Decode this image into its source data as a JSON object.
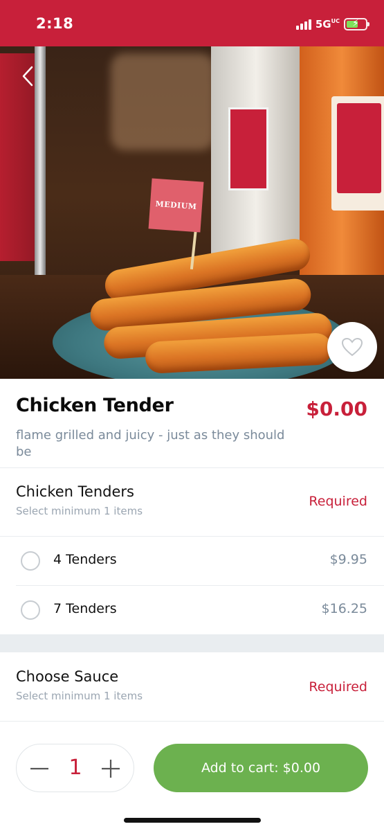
{
  "status_bar": {
    "time": "2:18",
    "network": "5G",
    "network_suffix": "UC",
    "bg_color": "#c8203a"
  },
  "hero": {
    "flag_text": "MEDIUM",
    "back_icon": "chevron-left-icon",
    "favorite_icon": "heart-outline-icon"
  },
  "product": {
    "title": "Chicken Tender",
    "price": "$0.00",
    "description": "flame grilled and juicy - just as they should be"
  },
  "groups": [
    {
      "title": "Chicken Tenders",
      "subtitle": "Select minimum 1 items",
      "required_label": "Required",
      "options": [
        {
          "label": "4 Tenders",
          "price": "$9.95",
          "selected": false
        },
        {
          "label": "7 Tenders",
          "price": "$16.25",
          "selected": false
        }
      ]
    },
    {
      "title": "Choose Sauce",
      "subtitle": "Select minimum 1 items",
      "required_label": "Required"
    }
  ],
  "cart": {
    "quantity": "1",
    "add_label": "Add to cart: $0.00",
    "accent": "#6cb14f"
  }
}
